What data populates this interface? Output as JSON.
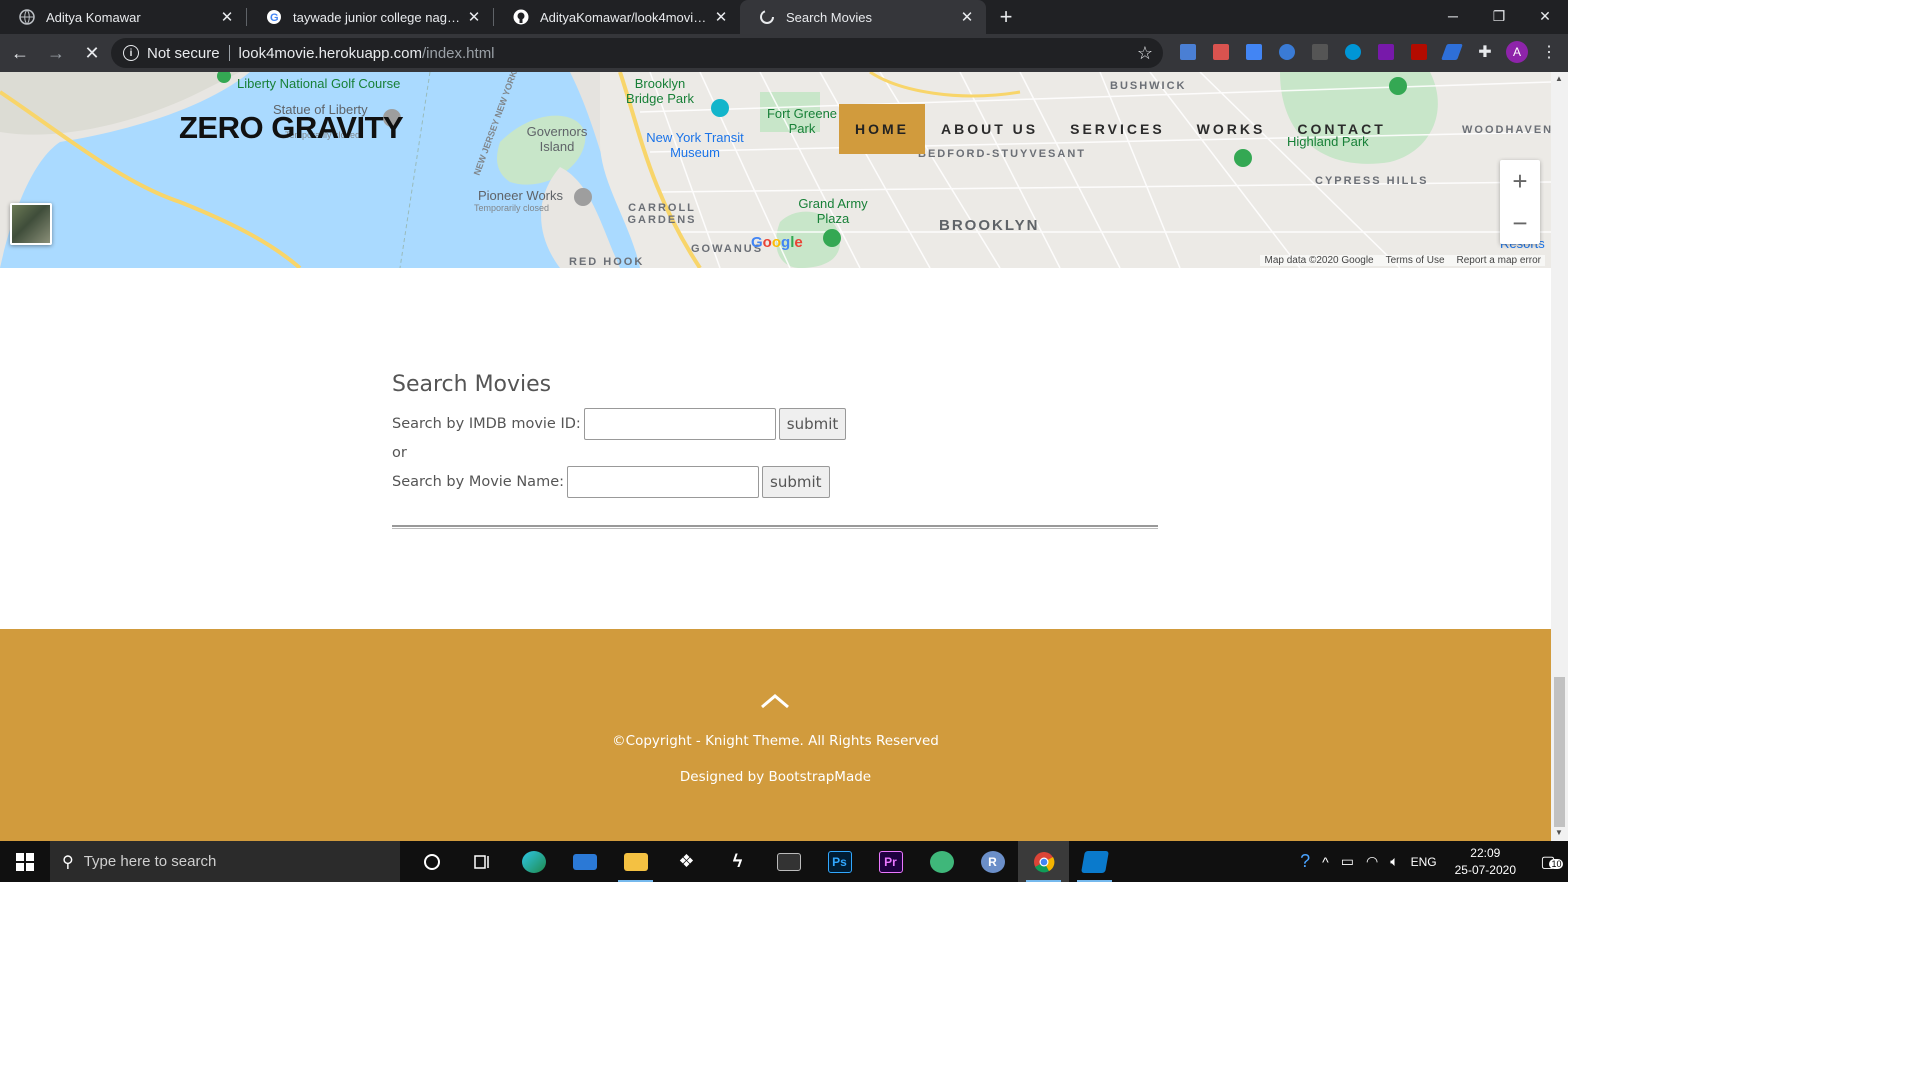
{
  "browser": {
    "tabs": [
      {
        "title": "Aditya Komawar",
        "icon": "globe-icon",
        "active": false
      },
      {
        "title": "taywade junior college nagput - G",
        "icon": "google-icon",
        "active": false
      },
      {
        "title": "AdityaKomawar/look4movie: Yo",
        "icon": "github-icon",
        "active": false
      },
      {
        "title": "Search Movies",
        "icon": "loading-icon",
        "active": true
      }
    ],
    "security_label": "Not secure",
    "url_host": "look4movie.herokuapp.com",
    "url_path": "/index.html"
  },
  "map": {
    "labels": {
      "liberty_course": "Liberty National Golf Course",
      "statue": "Statue of Liberty",
      "statue_status": "Temporarily closed",
      "brooklyn_bridge_park": "Brooklyn Bridge Park",
      "governors_island": "Governors Island",
      "transit_museum": "New York Transit Museum",
      "fort_greene": "Fort Greene Park",
      "pioneer_works": "Pioneer Works",
      "pioneer_status": "Temporarily closed",
      "carroll_gardens": "CARROLL GARDENS",
      "gowanus": "GOWANUS",
      "red_hook": "RED HOOK",
      "grand_army": "Grand Army Plaza",
      "bedford": "BEDFORD-STUYVESANT",
      "brooklyn": "BROOKLYN",
      "bushwick": "BUSHWICK",
      "highland_park": "Highland Park",
      "cypress_hills": "CYPRESS HILLS",
      "woodhaven": "WOODHAVEN",
      "nj_ny": "NEW JERSEY NEW YORK",
      "resorts": "Resorts"
    },
    "google": "Google",
    "attribution": [
      "Map data ©2020 Google",
      "Terms of Use",
      "Report a map error"
    ]
  },
  "site": {
    "brand": "ZERO GRAVITY",
    "nav": [
      {
        "label": "HOME",
        "active": true
      },
      {
        "label": "ABOUT US",
        "active": false
      },
      {
        "label": "SERVICES",
        "active": false
      },
      {
        "label": "WORKS",
        "active": false
      },
      {
        "label": "CONTACT",
        "active": false
      }
    ]
  },
  "search": {
    "heading": "Search Movies",
    "imdb_label": "Search by IMDB movie ID:",
    "imdb_value": "",
    "or_text": "or",
    "name_label": "Search by Movie Name:",
    "name_value": "",
    "submit_label": "submit"
  },
  "footer": {
    "copyright": "©Copyright - Knight Theme. All Rights Reserved",
    "designed": "Designed by BootstrapMade",
    "accent": "#d19b3d"
  },
  "taskbar": {
    "search_placeholder": "Type here to search",
    "apps": [
      "cortana-icon",
      "task-view-icon",
      "edge-icon",
      "mail-icon",
      "file-explorer-icon",
      "dropbox-icon",
      "wave-icon",
      "terminal-icon",
      "photoshop-icon",
      "premiere-icon",
      "maps-icon",
      "r-icon",
      "chrome-icon",
      "vscode-icon"
    ],
    "lang": "ENG",
    "time": "22:09",
    "date": "25-07-2020",
    "notifications": "10"
  }
}
